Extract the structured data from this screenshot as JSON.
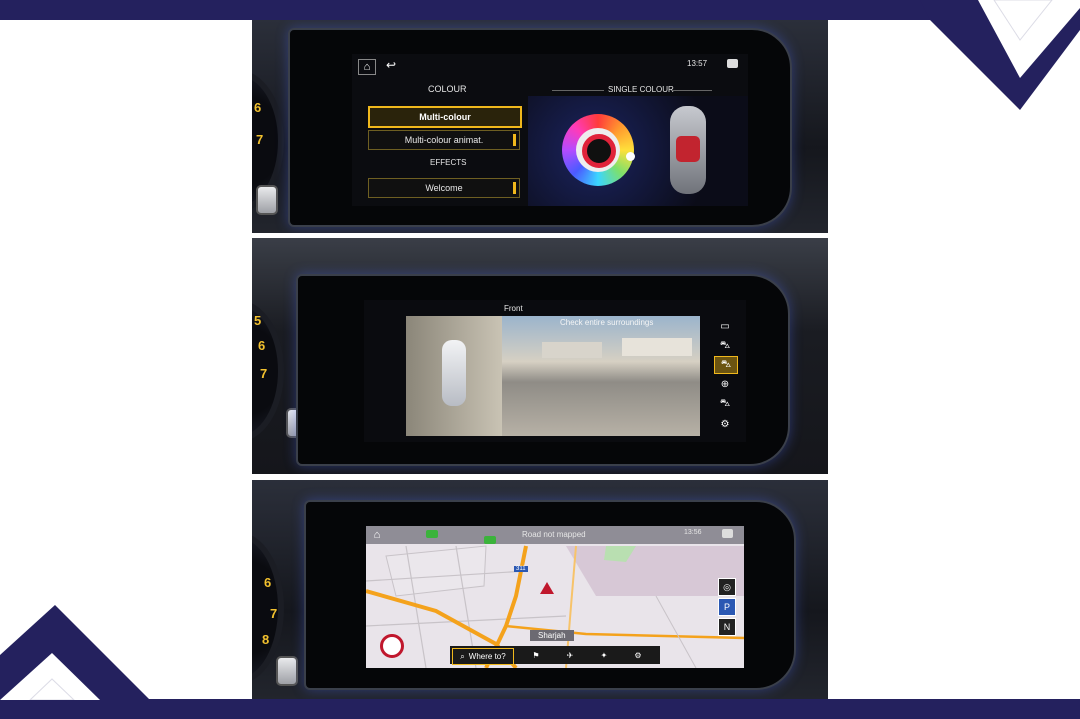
{
  "panel1": {
    "time": "13:57",
    "colour_heading": "COLOUR",
    "single_colour_heading": "SINGLE COLOUR",
    "effects_heading": "EFFECTS",
    "items": [
      "Multi-colour",
      "Multi-colour animat.",
      "Welcome"
    ],
    "gauge_numbers": [
      "6",
      "7"
    ]
  },
  "panel2": {
    "camera_label": "Front",
    "camera_notice": "Check entire surroundings",
    "gauge_numbers": [
      "5",
      "6",
      "7"
    ]
  },
  "panel3": {
    "time": "13:56",
    "road_status": "Road not mapped",
    "city_label": "Sharjah",
    "route_sign": "311",
    "search_label": "Where to?",
    "gauge_numbers": [
      "6",
      "7",
      "8"
    ]
  },
  "colors": {
    "band": "#24215e",
    "accent": "#f0b81c",
    "map_road": "#f4a21c"
  }
}
